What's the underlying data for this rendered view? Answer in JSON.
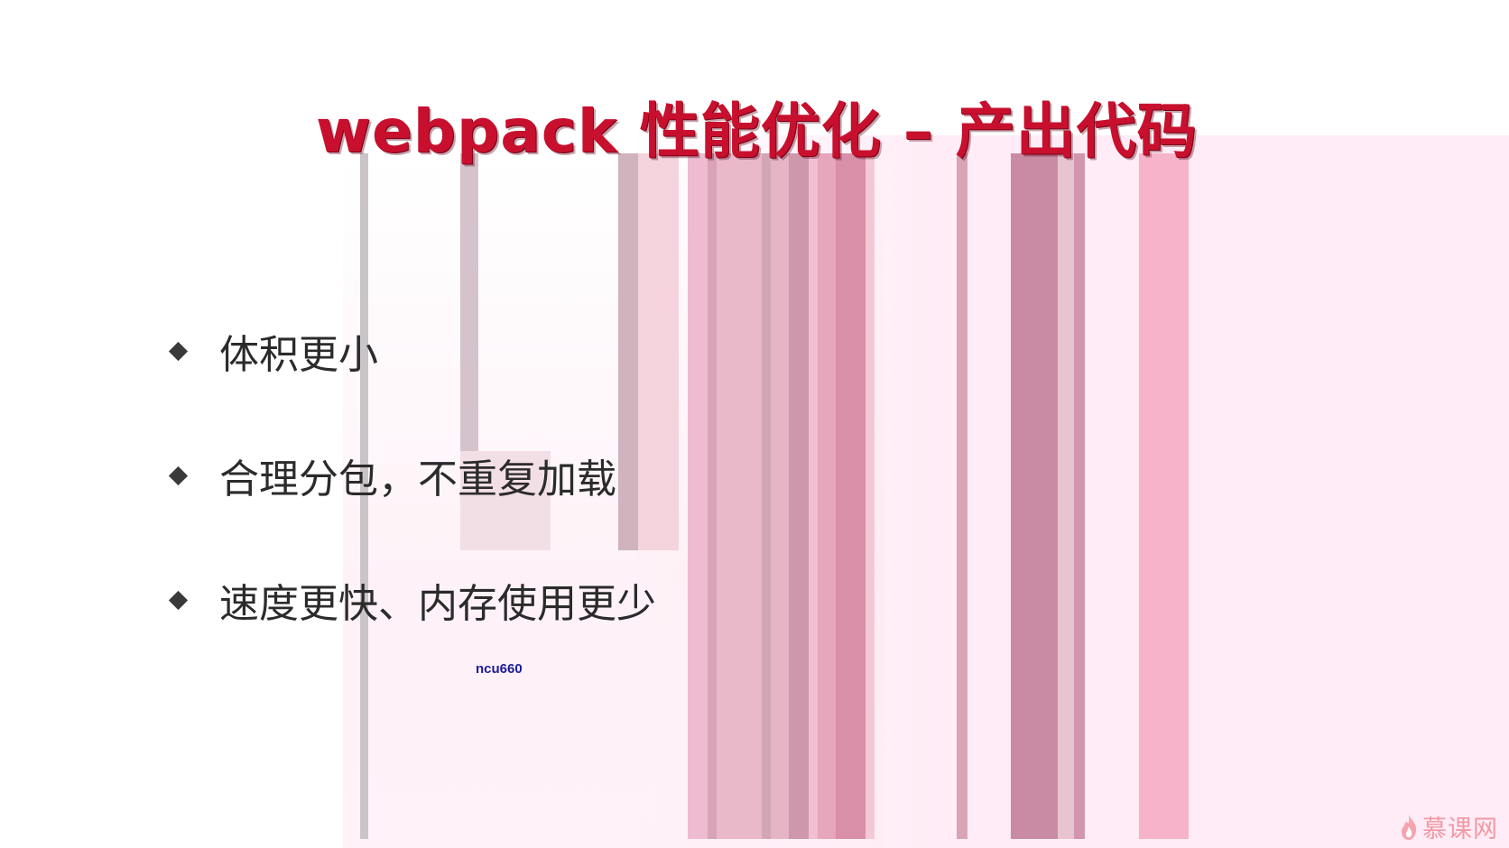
{
  "slide": {
    "title": "webpack 性能优化 – 产出代码",
    "bullets": [
      "体积更小",
      "合理分包，不重复加载",
      "速度更快、内存使用更少"
    ],
    "watermark": "ncu660",
    "brand": "慕课网"
  },
  "colors": {
    "title": "#c8102e",
    "text": "#2b2b2b",
    "watermark": "#1a1aa0",
    "brand": "#f09aa4"
  },
  "icons": {
    "bullet": "diamond-bullet-icon",
    "brand": "flame-icon"
  }
}
